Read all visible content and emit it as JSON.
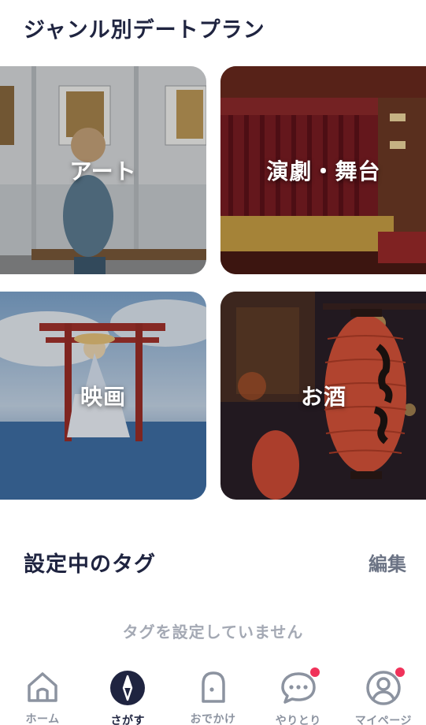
{
  "genre": {
    "title": "ジャンル別デートプラン",
    "cards": [
      {
        "label": "アート",
        "image": "woman-viewing-gallery-art"
      },
      {
        "label": "演劇・舞台",
        "image": "theater-stage-red-curtain"
      },
      {
        "label": "映画",
        "image": "anime-girl-torii-gate-water"
      },
      {
        "label": "お酒",
        "image": "red-paper-lantern-izakaya"
      }
    ]
  },
  "tags": {
    "title": "設定中のタグ",
    "edit_label": "編集",
    "empty_message": "タグを設定していません"
  },
  "tabbar": {
    "items": [
      {
        "label": "ホーム",
        "icon": "home-icon",
        "active": false,
        "badge": false
      },
      {
        "label": "さがす",
        "icon": "compass-icon",
        "active": true,
        "badge": false
      },
      {
        "label": "おでかけ",
        "icon": "ticket-icon",
        "active": false,
        "badge": false
      },
      {
        "label": "やりとり",
        "icon": "chat-icon",
        "active": false,
        "badge": true
      },
      {
        "label": "マイページ",
        "icon": "user-icon",
        "active": false,
        "badge": true
      }
    ]
  },
  "colors": {
    "text_primary": "#1f2440",
    "text_muted": "#a4a9b4",
    "badge": "#f0325a"
  }
}
